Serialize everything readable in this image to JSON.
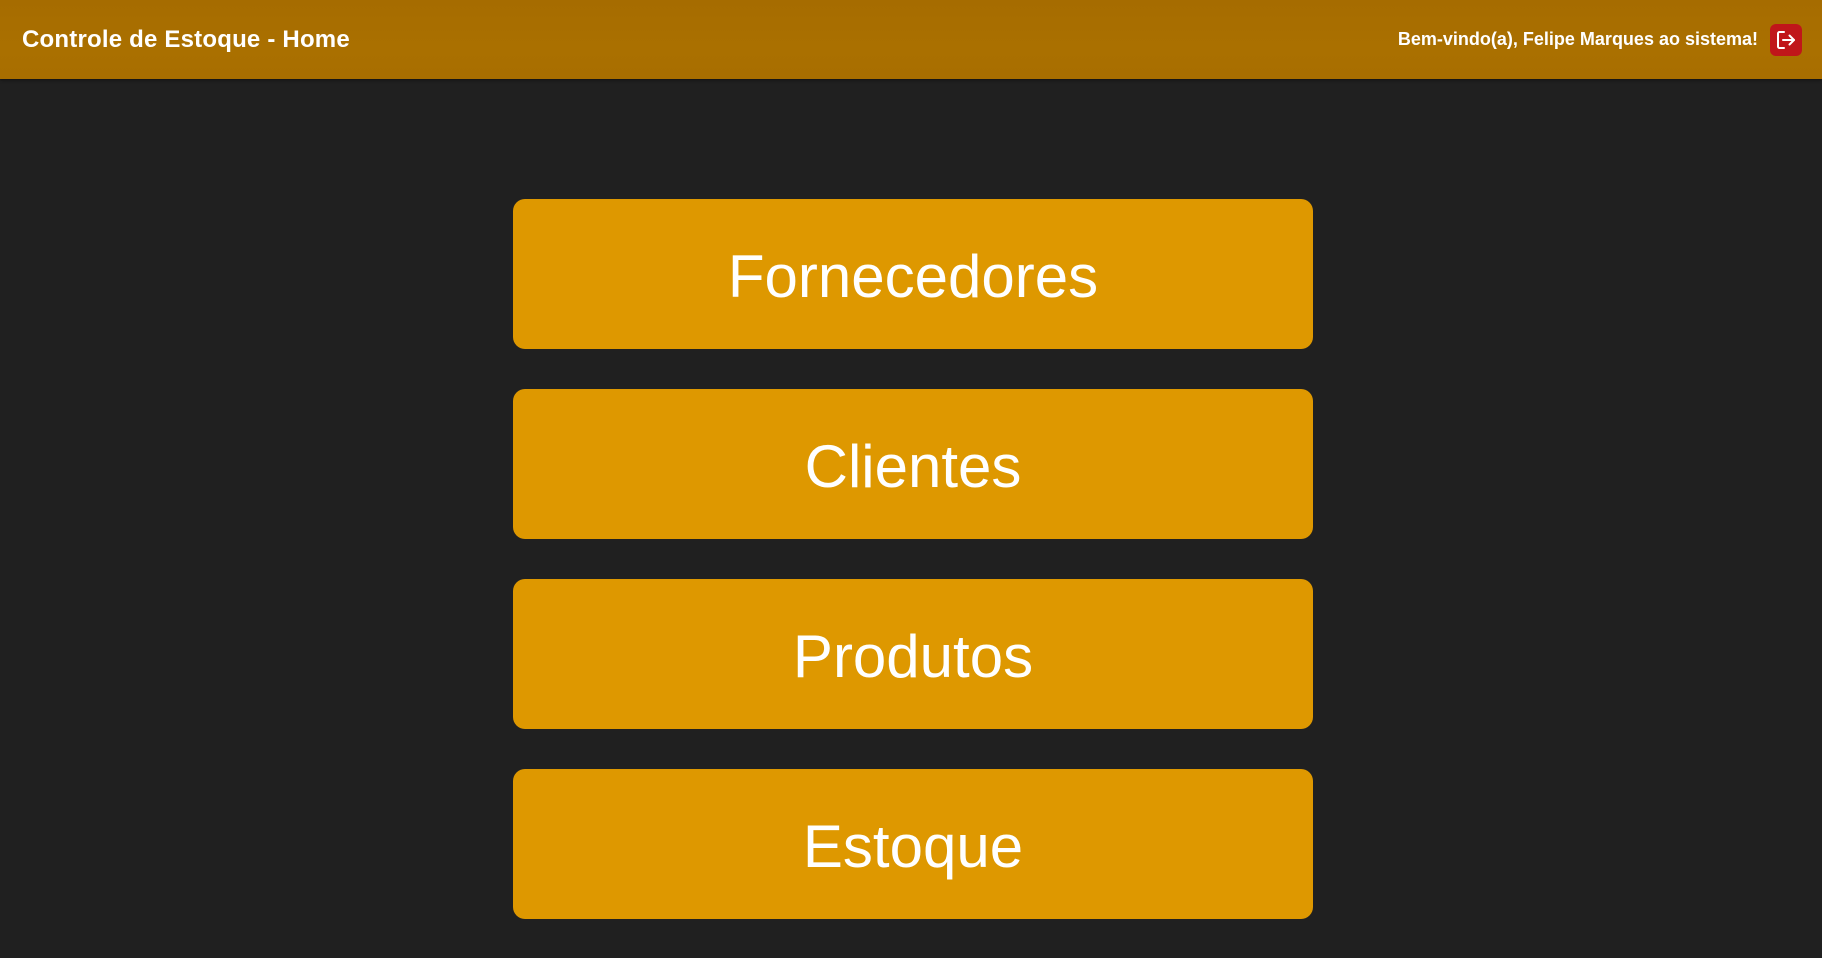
{
  "header": {
    "title": "Controle de Estoque - Home",
    "welcome_text": "Bem-vindo(a), Felipe Marques ao sistema!",
    "logout_icon": "logout-icon"
  },
  "menu": {
    "items": [
      {
        "label": "Fornecedores"
      },
      {
        "label": "Clientes"
      },
      {
        "label": "Produtos"
      },
      {
        "label": "Estoque"
      }
    ]
  },
  "colors": {
    "header_background": "#aa7000",
    "page_background": "#202020",
    "button_background": "#de9800",
    "logout_background": "#c0161a",
    "text": "#ffffff"
  }
}
